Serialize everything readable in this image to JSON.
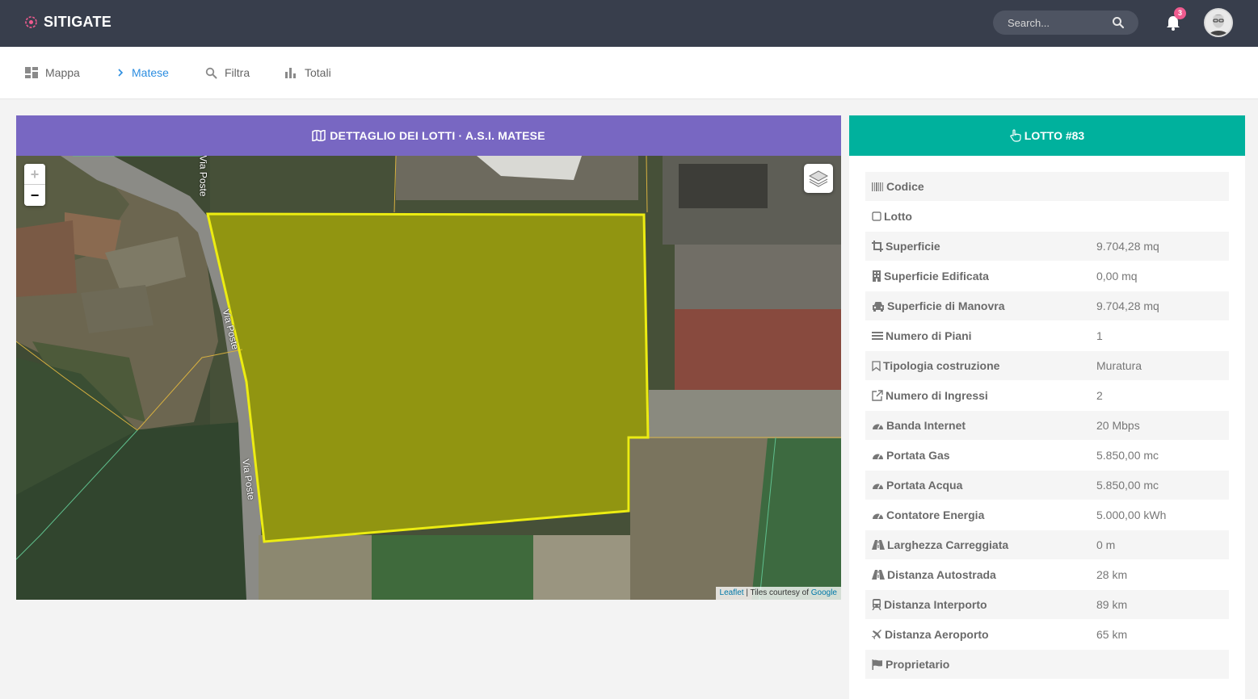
{
  "header": {
    "brand": "SITIGATE",
    "search_placeholder": "Search...",
    "notifications_count": "3"
  },
  "nav": {
    "items": [
      {
        "label": "Mappa",
        "icon": "dashboard-icon"
      },
      {
        "label": "Matese",
        "icon": "chevron-right-icon"
      },
      {
        "label": "Filtra",
        "icon": "search-icon"
      },
      {
        "label": "Totali",
        "icon": "bar-chart-icon"
      }
    ]
  },
  "map_panel": {
    "title": "DETTAGLIO DEI LOTTI · A.S.I. MATESE",
    "zoom_in": "+",
    "zoom_out": "−",
    "street_label": "Via Poste",
    "attribution_link1": "Leaflet",
    "attribution_sep": " | Tiles courtesy of ",
    "attribution_link2": "Google",
    "highlight_color": "#e8e000"
  },
  "detail_panel": {
    "title": "LOTTO #83",
    "properties": [
      {
        "label": "Codice",
        "value": "",
        "icon": "barcode-icon"
      },
      {
        "label": "Lotto",
        "value": "",
        "icon": "square-icon"
      },
      {
        "label": "Superficie",
        "value": "9.704,28 mq",
        "icon": "crop-icon"
      },
      {
        "label": "Superficie Edificata",
        "value": "0,00 mq",
        "icon": "building-icon"
      },
      {
        "label": "Superficie di Manovra",
        "value": "9.704,28 mq",
        "icon": "car-icon"
      },
      {
        "label": "Numero di Piani",
        "value": "1",
        "icon": "bars-icon"
      },
      {
        "label": "Tipologia costruzione",
        "value": "Muratura",
        "icon": "bookmark-icon"
      },
      {
        "label": "Numero di Ingressi",
        "value": "2",
        "icon": "external-link-icon"
      },
      {
        "label": "Banda Internet",
        "value": "20 Mbps",
        "icon": "gauge-icon"
      },
      {
        "label": "Portata Gas",
        "value": "5.850,00 mc",
        "icon": "gauge-icon"
      },
      {
        "label": "Portata Acqua",
        "value": "5.850,00 mc",
        "icon": "gauge-icon"
      },
      {
        "label": "Contatore Energia",
        "value": "5.000,00 kWh",
        "icon": "gauge-icon"
      },
      {
        "label": "Larghezza Carreggiata",
        "value": "0 m",
        "icon": "road-icon"
      },
      {
        "label": "Distanza Autostrada",
        "value": "28 km",
        "icon": "road-icon"
      },
      {
        "label": "Distanza Interporto",
        "value": "89 km",
        "icon": "train-icon"
      },
      {
        "label": "Distanza Aeroporto",
        "value": "65 km",
        "icon": "plane-icon"
      },
      {
        "label": "Proprietario",
        "value": "",
        "icon": "flag-icon"
      }
    ]
  }
}
